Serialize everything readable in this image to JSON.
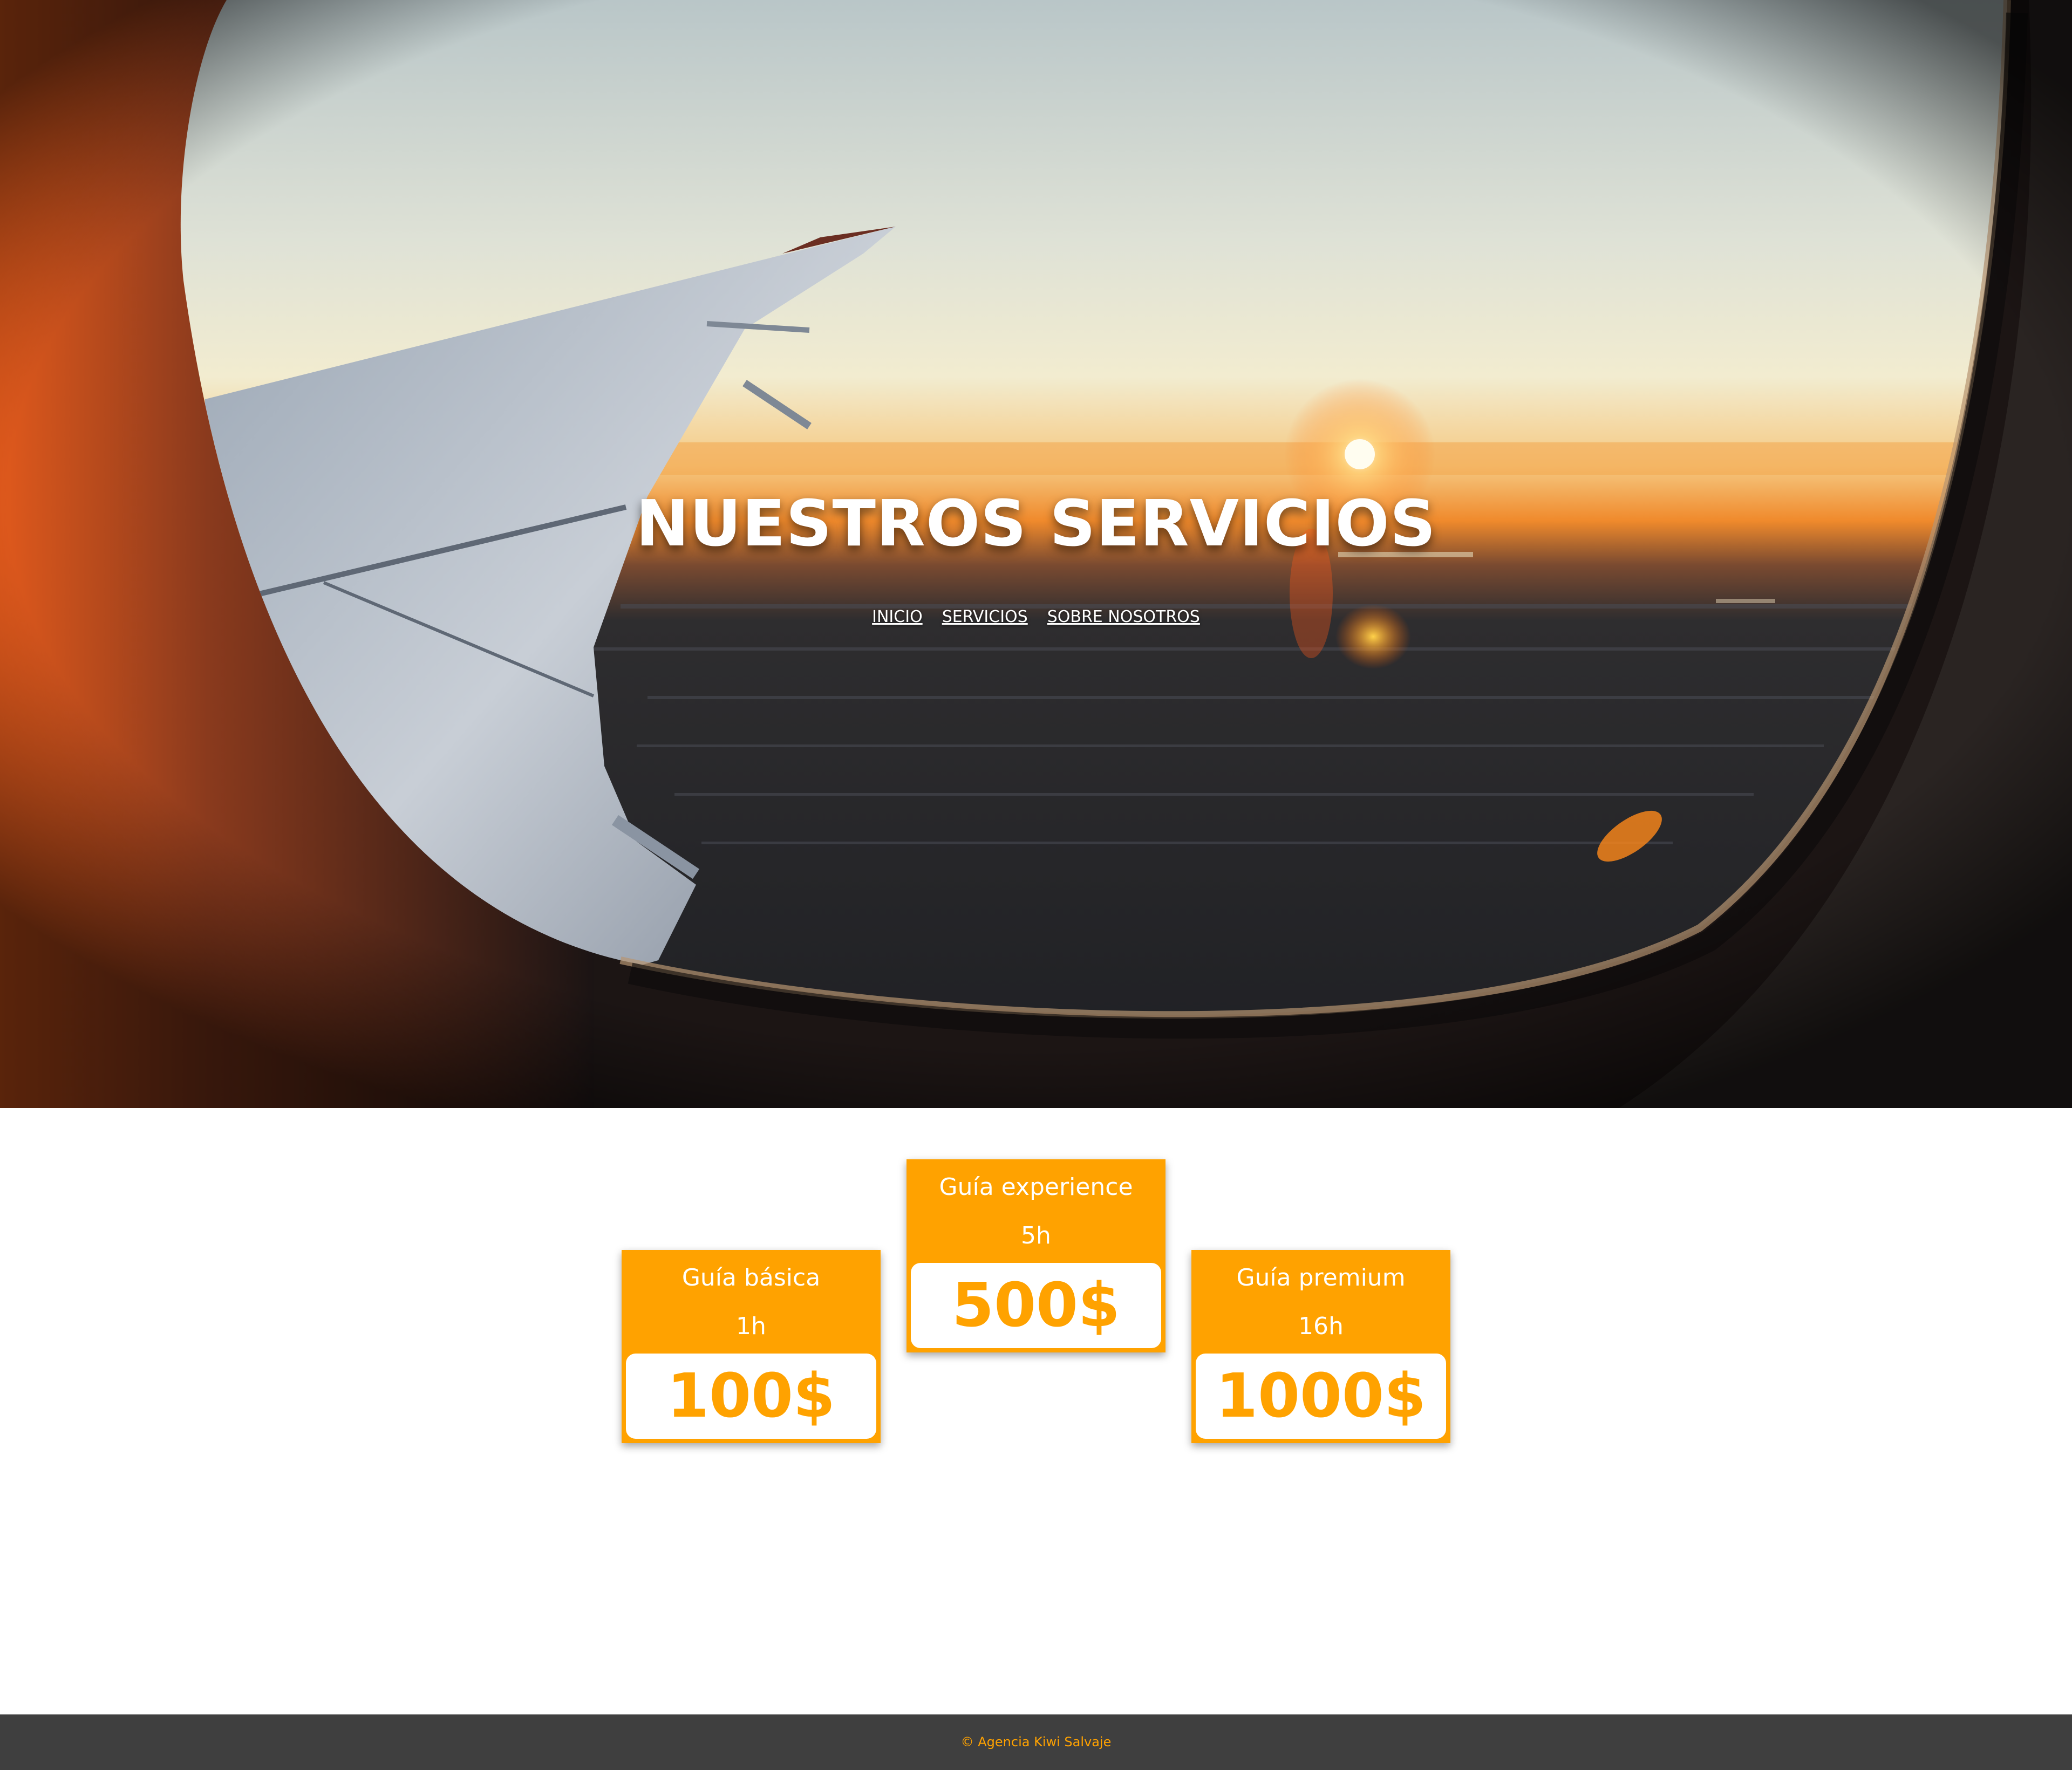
{
  "hero": {
    "title": "NUESTROS SERVICIOS",
    "background_description": "airplane-window-sunset-photo"
  },
  "nav": {
    "items": [
      {
        "label": "INICIO"
      },
      {
        "label": "SERVICIOS"
      },
      {
        "label": "SOBRE NOSOTROS"
      }
    ]
  },
  "services": [
    {
      "name": "Guía básica",
      "duration": "1h",
      "price": "100$"
    },
    {
      "name": "Guía experience",
      "duration": "5h",
      "price": "500$"
    },
    {
      "name": "Guía premium",
      "duration": "16h",
      "price": "1000$"
    }
  ],
  "footer": {
    "text": "© Agencia Kiwi Salvaje"
  },
  "colors": {
    "accent": "#ffa200",
    "footer_bg": "#3f3f3f",
    "text_light": "#ffffff"
  }
}
